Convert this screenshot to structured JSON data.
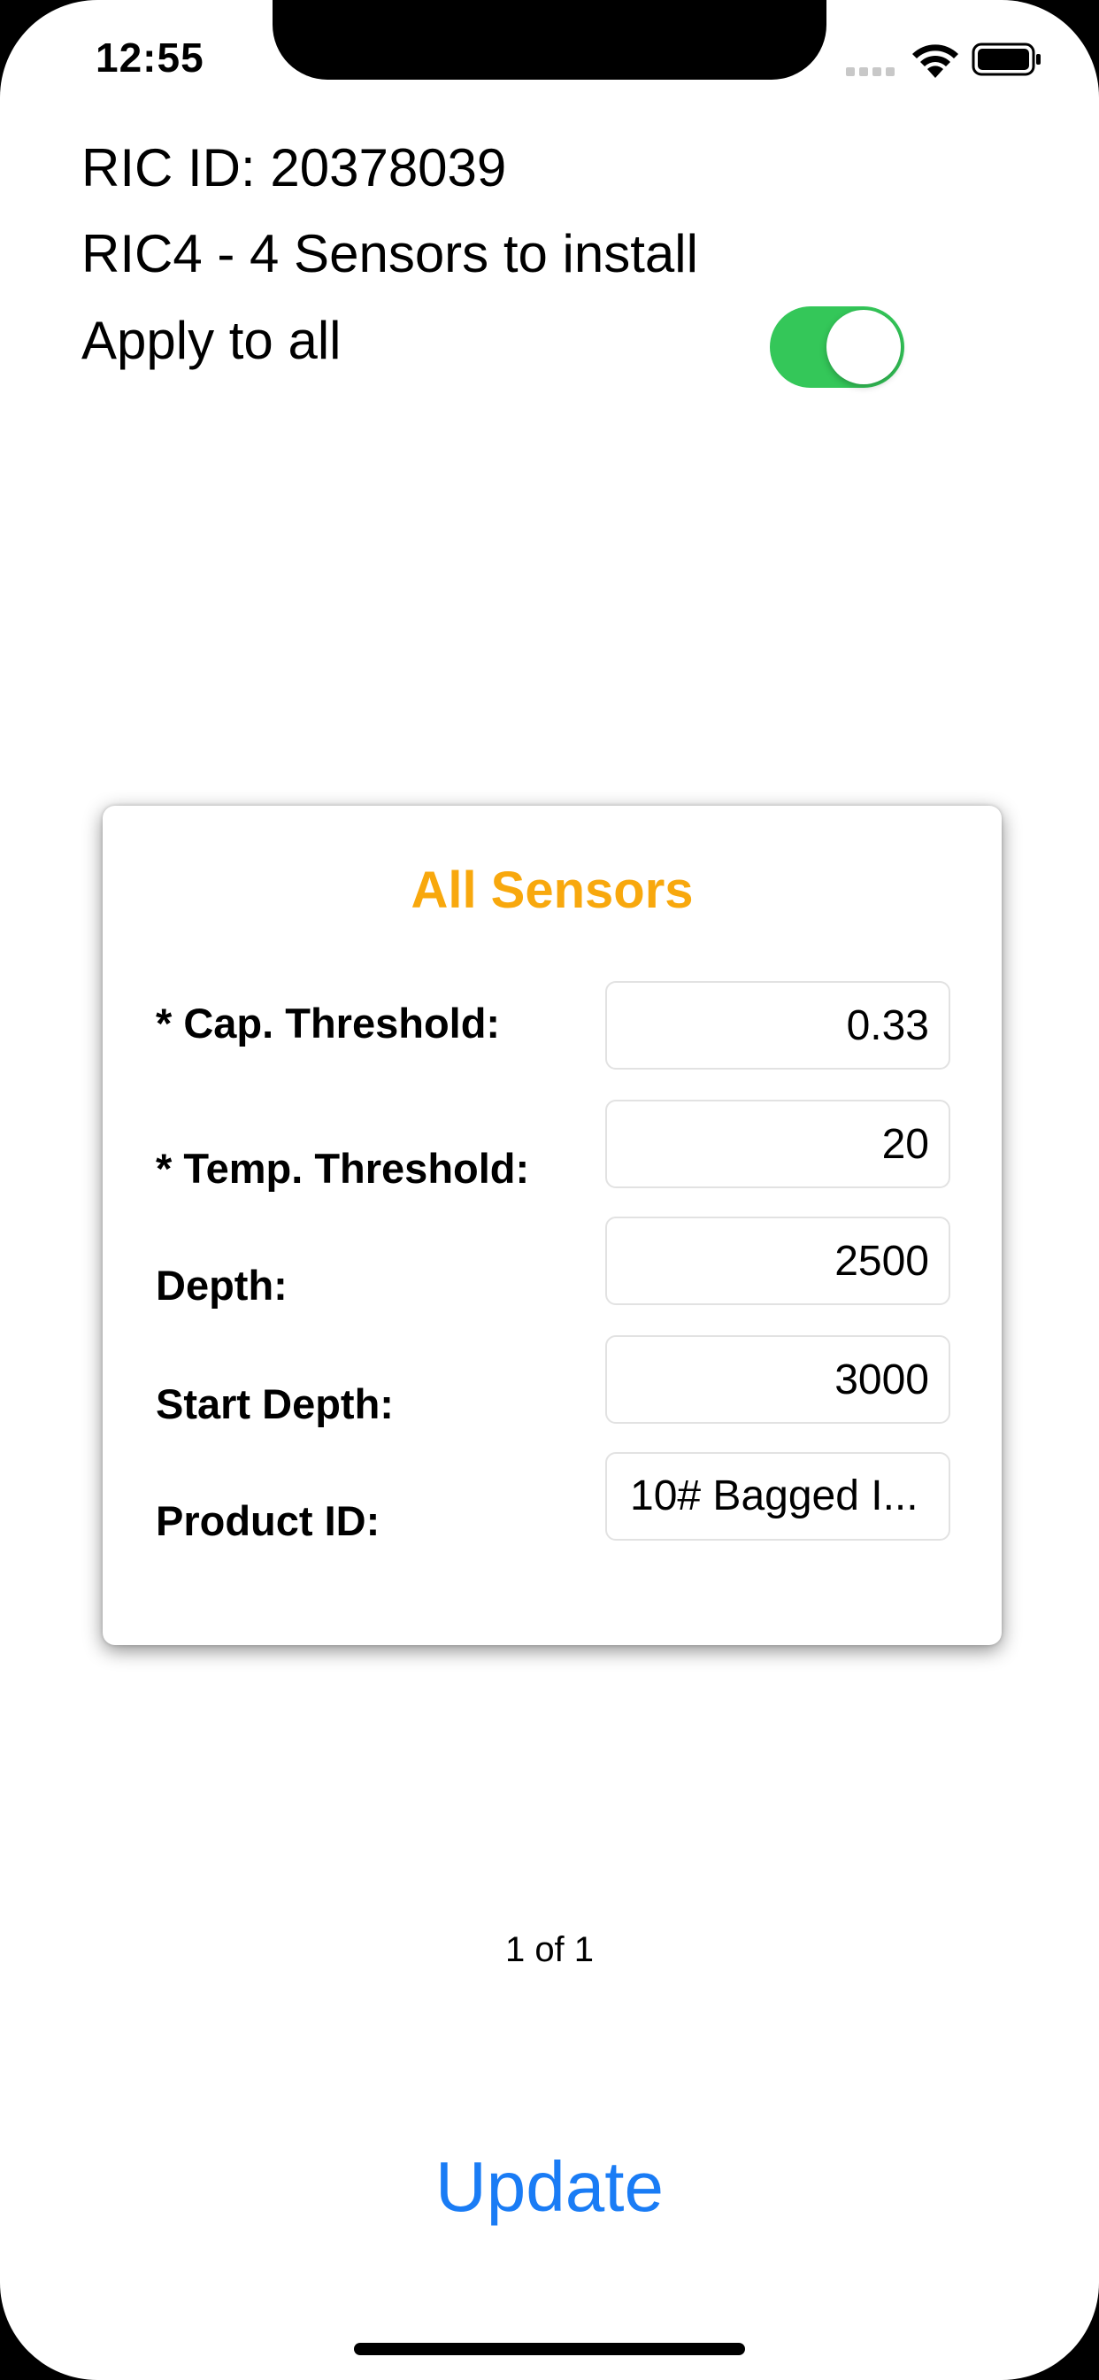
{
  "status_bar": {
    "time": "12:55",
    "icons": [
      "signal-icon",
      "wifi-icon",
      "battery-icon"
    ]
  },
  "header": {
    "ric_id": "RIC ID: 20378039",
    "ric_type": "RIC4 - 4 Sensors to install",
    "apply_label": "Apply to all",
    "apply_to_all_on": true
  },
  "card": {
    "title": "All Sensors",
    "fields": [
      {
        "label": "* Cap. Threshold:",
        "value": "0.33"
      },
      {
        "label": "* Temp. Threshold:",
        "value": "20"
      },
      {
        "label": "Depth:",
        "value": "2500"
      },
      {
        "label": "Start Depth:",
        "value": "3000"
      },
      {
        "label": "Product ID:",
        "value": "10# Bagged I..."
      }
    ]
  },
  "pager": {
    "text": "1 of 1"
  },
  "actions": {
    "update_label": "Update"
  },
  "colors": {
    "accent": "#1a7cf5",
    "title": "#f8a80d",
    "toggle_on": "#34c759"
  }
}
